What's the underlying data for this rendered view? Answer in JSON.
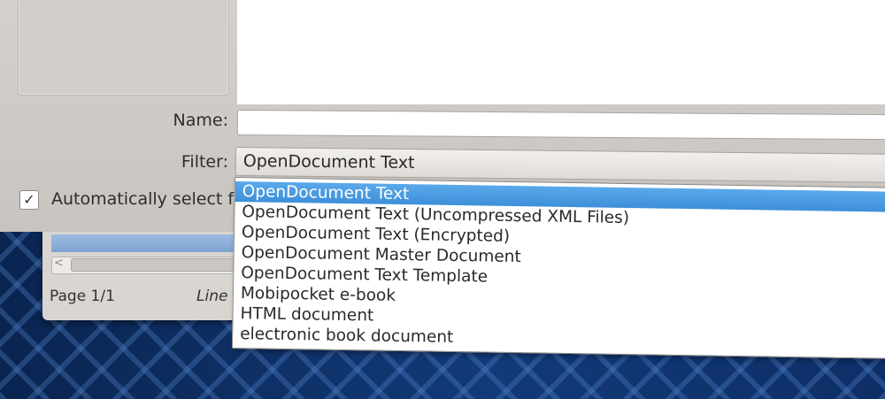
{
  "dialog": {
    "name_label": "Name:",
    "name_value": "",
    "filter_label": "Filter:",
    "filter_value": "OpenDocument Text",
    "auto_select_label": "Automatically select f",
    "auto_select_checked": true
  },
  "dropdown": {
    "selected_index": 0,
    "items": [
      "OpenDocument Text",
      "OpenDocument Text (Uncompressed XML Files)",
      "OpenDocument Text (Encrypted)",
      "OpenDocument Master Document",
      "OpenDocument Text Template",
      "Mobipocket e-book",
      "HTML document",
      "electronic book document"
    ]
  },
  "background_window": {
    "page_label": "Page 1/1",
    "line_label": "Line"
  },
  "colors": {
    "dialog_bg": "#cdc9c5",
    "selection": "#3d8fd9",
    "desktop": "#0c2a5c"
  }
}
